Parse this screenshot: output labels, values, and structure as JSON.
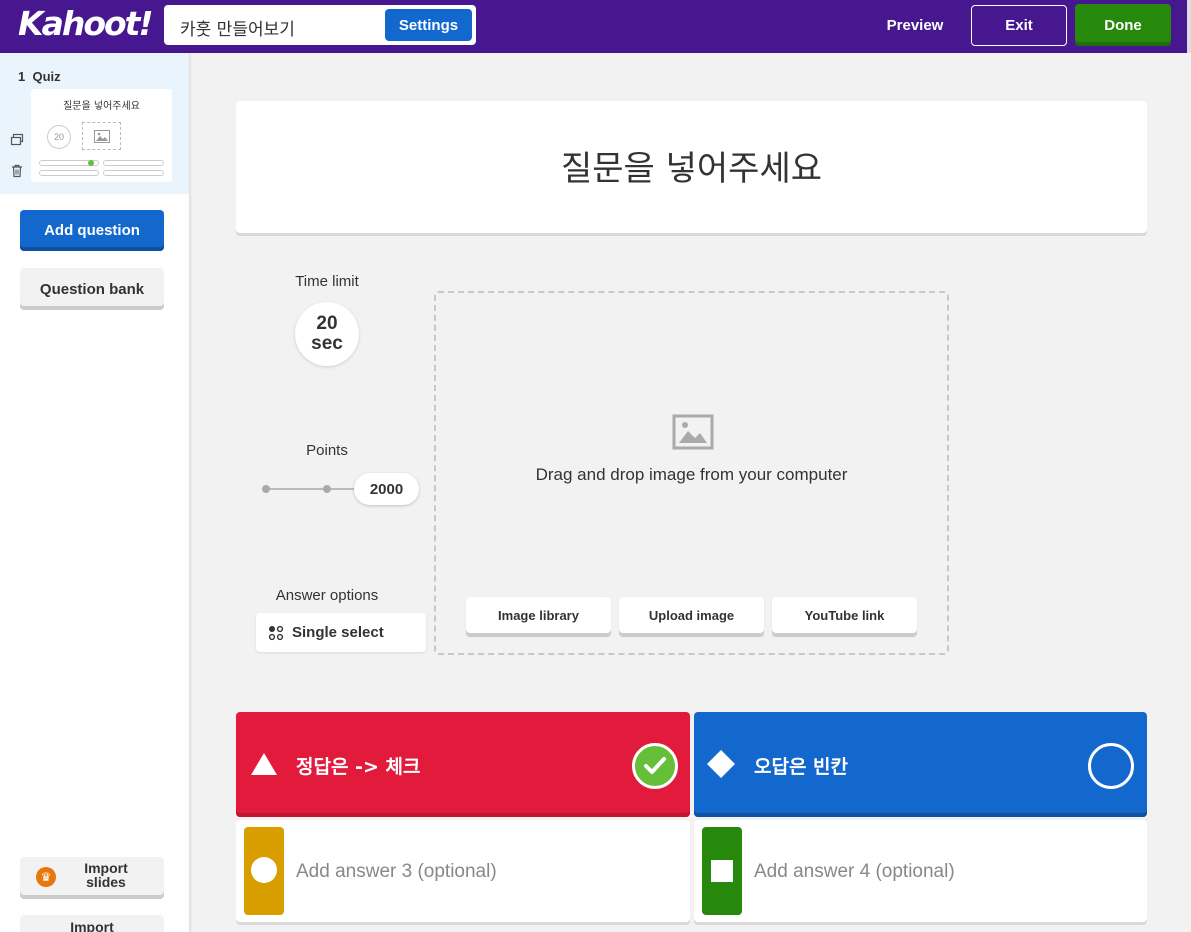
{
  "header": {
    "logo": "Kahoot!",
    "kahoot_title": "카훗 만들어보기",
    "settings_label": "Settings",
    "preview_label": "Preview",
    "exit_label": "Exit",
    "done_label": "Done"
  },
  "sidebar": {
    "slides": [
      {
        "number": "1",
        "type": "Quiz",
        "thumb_title": "질문을 넣어주세요",
        "thumb_timer": "20"
      }
    ],
    "add_question_label": "Add question",
    "question_bank_label": "Question bank",
    "import_slides_label": "Import slides",
    "import_label": "Import"
  },
  "editor": {
    "question": "질문을 넣어주세요",
    "time_limit_label": "Time limit",
    "time_limit_value": "20",
    "time_limit_unit": "sec",
    "points_label": "Points",
    "points_value": "2000",
    "answer_options_label": "Answer options",
    "answer_options_value": "Single select",
    "media": {
      "drop_text": "Drag and drop image from your computer",
      "image_library_label": "Image library",
      "upload_image_label": "Upload image",
      "youtube_link_label": "YouTube link"
    }
  },
  "answers": [
    {
      "text": "정답은 -> 체크",
      "shape": "triangle-icon",
      "color": "#e21b3c",
      "correct": true
    },
    {
      "text": "오답은 빈칸",
      "shape": "diamond-icon",
      "color": "#1368ce",
      "correct": false
    },
    {
      "placeholder": "Add answer 3 (optional)",
      "shape": "circle-icon",
      "color": "#d89e00"
    },
    {
      "placeholder": "Add answer 4 (optional)",
      "shape": "square-icon",
      "color": "#26890c"
    }
  ]
}
